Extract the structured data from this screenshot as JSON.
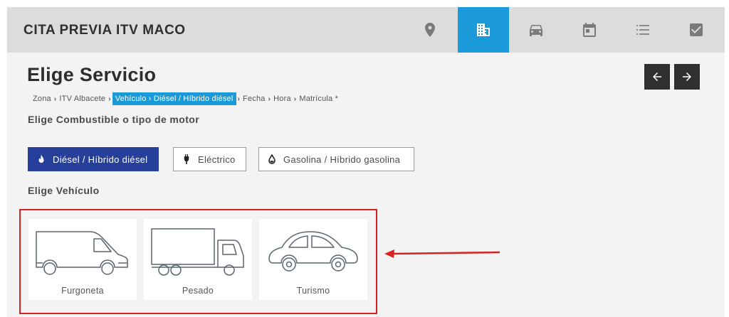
{
  "app": {
    "brand": "CITA PREVIA ITV MACO"
  },
  "nav": [
    {
      "icon": "map-pin-icon",
      "active": false
    },
    {
      "icon": "building-icon",
      "active": true
    },
    {
      "icon": "car-icon",
      "active": false
    },
    {
      "icon": "calendar-icon",
      "active": false
    },
    {
      "icon": "list-icon",
      "active": false
    },
    {
      "icon": "checkbox-icon",
      "active": false
    }
  ],
  "page": {
    "title": "Elige Servicio"
  },
  "breadcrumb": {
    "zona": "Zona",
    "itv": "ITV Albacete",
    "active": "Vehículo › Diésel / Híbrido diésel",
    "fecha": "Fecha",
    "hora": "Hora",
    "matricula": "Matrícula *"
  },
  "sections": {
    "fuel_label": "Elige Combustible o tipo de motor",
    "vehicle_label": "Elige Vehículo"
  },
  "fuel_options": [
    {
      "label": "Diésel / Híbrido diésel",
      "icon": "flame-icon",
      "selected": true
    },
    {
      "label": "Eléctrico",
      "icon": "plug-icon",
      "selected": false
    },
    {
      "label": "Gasolina / Híbrido gasolina",
      "icon": "drop-icon",
      "selected": false
    }
  ],
  "vehicles": [
    {
      "label": "Furgoneta",
      "icon": "van-icon"
    },
    {
      "label": "Pesado",
      "icon": "truck-icon"
    },
    {
      "label": "Turismo",
      "icon": "beetle-car-icon"
    }
  ],
  "colors": {
    "accent": "#1a9ad9",
    "selected_fuel": "#253f9a",
    "highlight_border": "#d62222",
    "dark_button": "#303030"
  }
}
